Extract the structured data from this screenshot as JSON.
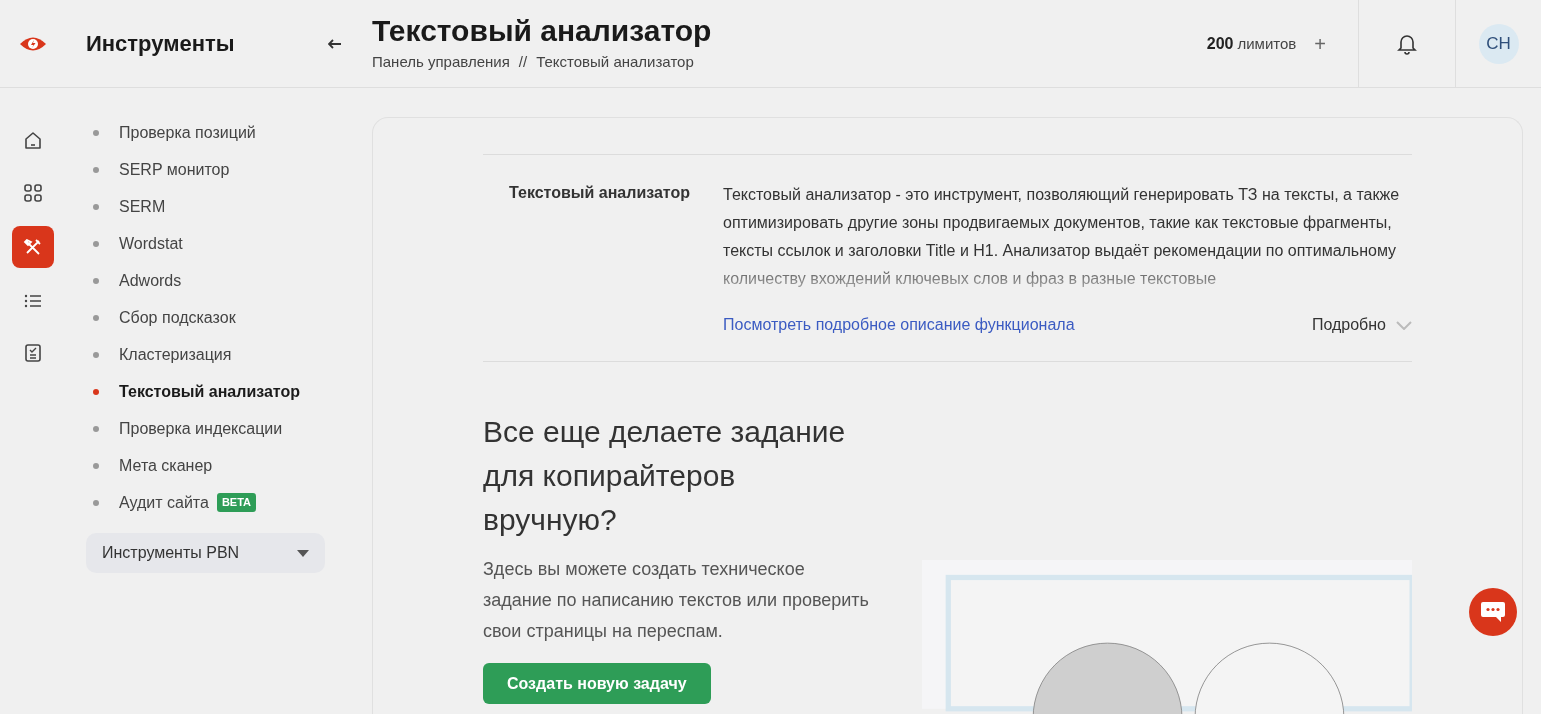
{
  "sidebar": {
    "title": "Инструменты",
    "rail": [
      {
        "kind": "home",
        "selected": false
      },
      {
        "kind": "grid",
        "selected": false
      },
      {
        "kind": "tools",
        "selected": true
      },
      {
        "kind": "list",
        "selected": false
      },
      {
        "kind": "report",
        "selected": false
      }
    ],
    "items": [
      {
        "label": "Проверка позиций",
        "selected": false
      },
      {
        "label": "SERP монитор",
        "selected": false
      },
      {
        "label": "SERM",
        "selected": false
      },
      {
        "label": "Wordstat",
        "selected": false
      },
      {
        "label": "Adwords",
        "selected": false
      },
      {
        "label": "Сбор подсказок",
        "selected": false
      },
      {
        "label": "Кластеризация",
        "selected": false
      },
      {
        "label": "Текстовый анализатор",
        "selected": true
      },
      {
        "label": "Проверка индексации",
        "selected": false
      },
      {
        "label": "Мета сканер",
        "selected": false
      },
      {
        "label": "Аудит сайта",
        "selected": false,
        "badge": "BETA"
      }
    ],
    "dropdown": "Инструменты PBN"
  },
  "header": {
    "title": "Текстовый анализатор",
    "breadcrumbs": [
      "Панель управления",
      "Текстовый анализатор"
    ],
    "breadcrumb_separator": "//",
    "limits_count": "200",
    "limits_label": "лимитов",
    "add": "+",
    "avatar": "CH"
  },
  "about": {
    "label": "Текстовый анализатор",
    "text": "Текстовый анализатор - это инструмент, позволяющий генерировать ТЗ на тексты, а также оптимизировать другие зоны продвигаемых документов, такие как текстовые фрагменты, тексты ссылок и заголовки Title и H1. Анализатор выдаёт рекомендации по оптимальному количеству вхождений ключевых слов и фраз в разные текстовые",
    "link": "Посмотреть подробное описание функционала",
    "toggle": "Подробно",
    "expanded": false
  },
  "promo": {
    "heading": "Все еще делаете задание для копирайтеров вручную?",
    "text": "Здесь вы можете создать техническое задание по написанию текстов или проверить свои страницы на переспам.",
    "button": "Создать новую задачу"
  }
}
